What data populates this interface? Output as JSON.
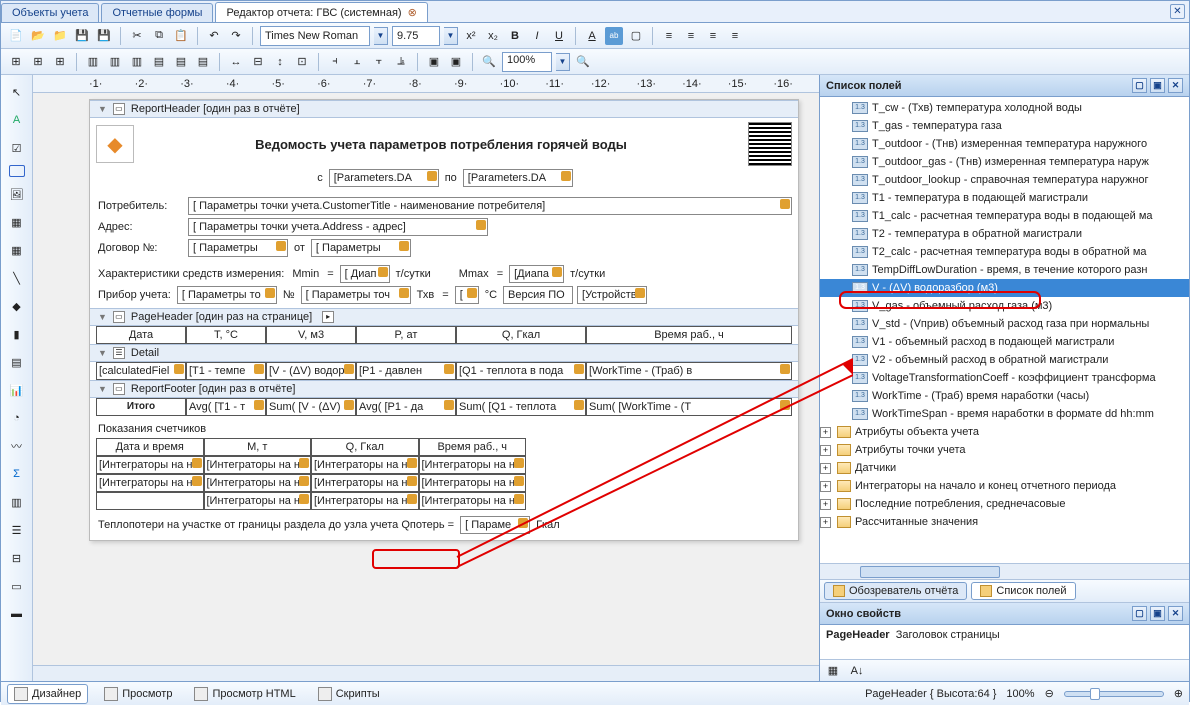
{
  "tabs": {
    "t0": "Объекты учета",
    "t1": "Отчетные формы",
    "t2": "Редактор отчета: ГВС (системная)"
  },
  "toolbar": {
    "font": "Times New Roman",
    "size": "9.75",
    "zoom": "100%"
  },
  "ruler": [
    "1",
    "2",
    "3",
    "4",
    "5",
    "6",
    "7",
    "8",
    "9",
    "10",
    "11",
    "12",
    "13",
    "14",
    "15",
    "16"
  ],
  "sections": {
    "reportHeader": "ReportHeader [один раз в отчёте]",
    "pageHeader": "PageHeader [один раз на странице]",
    "detail": "Detail",
    "reportFooter": "ReportFooter [один раз в отчёте]"
  },
  "report": {
    "title": "Ведомость учета параметров потребления горячей воды",
    "c": "с",
    "po": "по",
    "param": "[Parameters.DA",
    "consumerLbl": "Потребитель:",
    "consumerVal": "[ Параметры точки учета.CustomerTitle - наименование потребителя]",
    "addrLbl": "Адрес:",
    "addrVal": "[ Параметры точки учета.Address - адрес]",
    "contractLbl": "Договор №:",
    "contractVal": "[ Параметры",
    "ot": "от",
    "contractVal2": "[ Параметры",
    "charLbl": "Характеристики средств измерения:",
    "mmin": "Mmin",
    "eq": "=",
    "range": "[ Диап",
    "units": "т/сутки",
    "mmax": "Mmax",
    "deviceLbl": "Прибор учета:",
    "deviceVal": "[ Параметры то",
    "num": "№",
    "deviceVal2": "[ Параметры точ",
    "txv": "Тхв",
    "deg": "°C",
    "ver": "Версия ПО",
    "ustr": "[Устройств",
    "cols": {
      "date": "Дата",
      "t": "T, °C",
      "v": "V, м3",
      "p": "P, ат",
      "q": "Q, Гкал",
      "wt": "Время раб., ч"
    },
    "detailCells": {
      "c0": "[calculatedFiel",
      "c1": "[T1 - темпе",
      "c2": "[V - (ΔV) водора",
      "c3": "[P1 - давлен",
      "c4": "[Q1 - теплота в пода",
      "c5": "[WorkTime - (Траб) в"
    },
    "itogo": "Итого",
    "sums": {
      "s0": "Avg( [T1 - т",
      "s1": "Sum( [V - (ΔV)",
      "s2": "Avg( [P1 - да",
      "s3": "Sum( [Q1 - теплота",
      "s4": "Sum( [WorkTime - (Т"
    },
    "countersLbl": "Показания счетчиков",
    "cols2": {
      "dt": "Дата и время",
      "m": "M, т",
      "q": "Q, Гкал",
      "wt": "Время раб., ч"
    },
    "intg": "[Интеграторы на на",
    "lossLbl": "Теплопотери на участке от границы раздела до узла учета Qпотерь =",
    "lossVal": "[ Параме",
    "lossUnit": "Гкал"
  },
  "fieldsPanel": {
    "title": "Список полей",
    "items": [
      "T_cw - (Тхв) температура холодной воды",
      "T_gas - температура газа",
      "T_outdoor - (Тнв) измеренная температура наружного",
      "T_outdoor_gas - (Тнв) измеренная температура наруж",
      "T_outdoor_lookup - справочная температура наружног",
      "T1 - температура в подающей магистрали",
      "T1_calc - расчетная температура воды в подающей ма",
      "T2 - температура в обратной магистрали",
      "T2_calc - расчетная температура воды в обратной ма",
      "TempDiffLowDuration - время, в течение которого разн",
      "V - (ΔV) водоразбор (м3)",
      "V_gas - объемный расход газа (м3)",
      "V_std - (Vприв) объемный расход газа при нормальны",
      "V1 - объемный расход в подающей магистрали",
      "V2 - объемный расход в обратной магистрали",
      "VoltageTransformationCoeff - коэффициент трансформа",
      "WorkTime - (Траб) время наработки (часы)",
      "WorkTimeSpan - время наработки в формате dd hh:mm"
    ],
    "groups": [
      "Атрибуты объекта учета",
      "Атрибуты точки учета",
      "Датчики",
      "Интеграторы на начало и конец отчетного периода",
      "Последние потребления, среднечасовые",
      "Рассчитанные значения"
    ],
    "tabBrowser": "Обозреватель отчёта",
    "tabFields": "Список полей"
  },
  "props": {
    "title": "Окно свойств",
    "obj": "PageHeader",
    "desc": "Заголовок страницы"
  },
  "bottom": {
    "designer": "Дизайнер",
    "preview": "Просмотр",
    "previewHtml": "Просмотр HTML",
    "scripts": "Скрипты",
    "status": "PageHeader { Высота:64 }",
    "zoom": "100%"
  }
}
